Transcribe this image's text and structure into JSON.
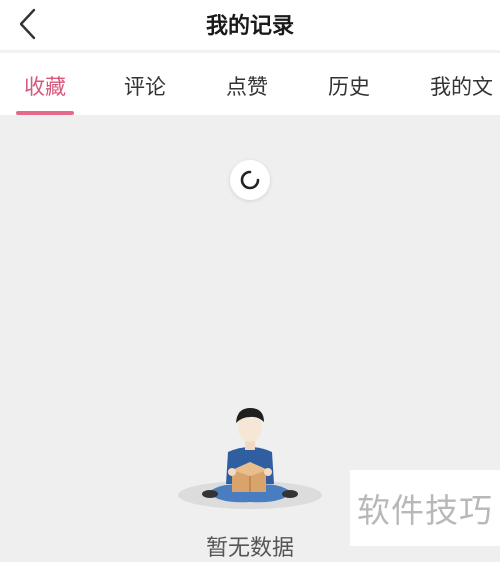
{
  "header": {
    "title": "我的记录",
    "back_icon": "chevron-left-icon"
  },
  "tabs": [
    {
      "label": "收藏",
      "active": true
    },
    {
      "label": "评论",
      "active": false
    },
    {
      "label": "点赞",
      "active": false
    },
    {
      "label": "历史",
      "active": false
    },
    {
      "label": "我的文",
      "active": false
    }
  ],
  "loading": {
    "icon": "loading-spinner-icon"
  },
  "empty_state": {
    "illustration": "person-opening-box-illustration",
    "text": "暂无数据"
  },
  "watermark": {
    "text": "软件技巧"
  },
  "colors": {
    "accent": "#e36a88",
    "active_tab_text": "#d6597c",
    "background": "#efefef"
  }
}
